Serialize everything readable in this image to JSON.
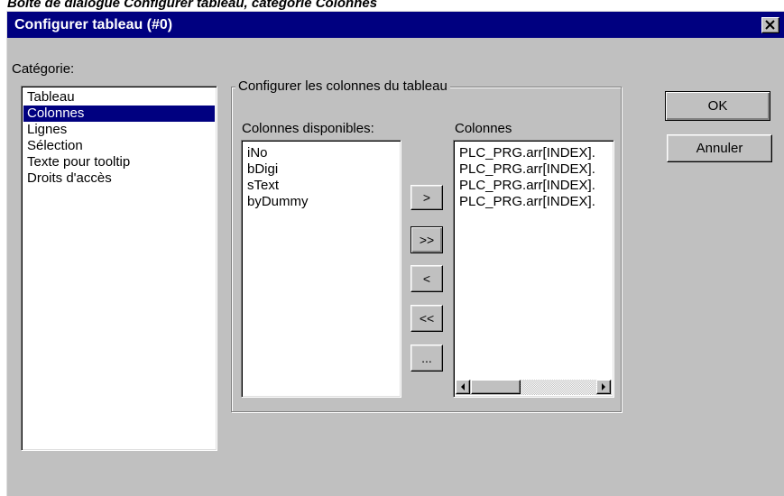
{
  "caption": "Boîte de dialogue Configurer tableau, catégorie Colonnes",
  "dialog": {
    "title": "Configurer tableau (#0)",
    "close_glyph": "✕"
  },
  "category": {
    "label": "Catégorie:",
    "items": [
      "Tableau",
      "Colonnes",
      "Lignes",
      "Sélection",
      "Texte pour tooltip",
      "Droits d'accès"
    ],
    "selected": "Colonnes"
  },
  "group": {
    "title": "Configurer les colonnes du tableau",
    "available_label": "Colonnes disponibles:",
    "available_items": [
      "iNo",
      "bDigi",
      "sText",
      "byDummy"
    ],
    "columns_label": "Colonnes",
    "columns_items": [
      "PLC_PRG.arr[INDEX].",
      "PLC_PRG.arr[INDEX].",
      "PLC_PRG.arr[INDEX].",
      "PLC_PRG.arr[INDEX]."
    ]
  },
  "transfer_buttons": {
    "add": ">",
    "add_all": ">>",
    "remove": "<",
    "remove_all": "<<",
    "more": "..."
  },
  "actions": {
    "ok": "OK",
    "cancel": "Annuler"
  },
  "colors": {
    "title_bar": "#000080",
    "face": "#c0c0c0",
    "selection": "#000080"
  }
}
